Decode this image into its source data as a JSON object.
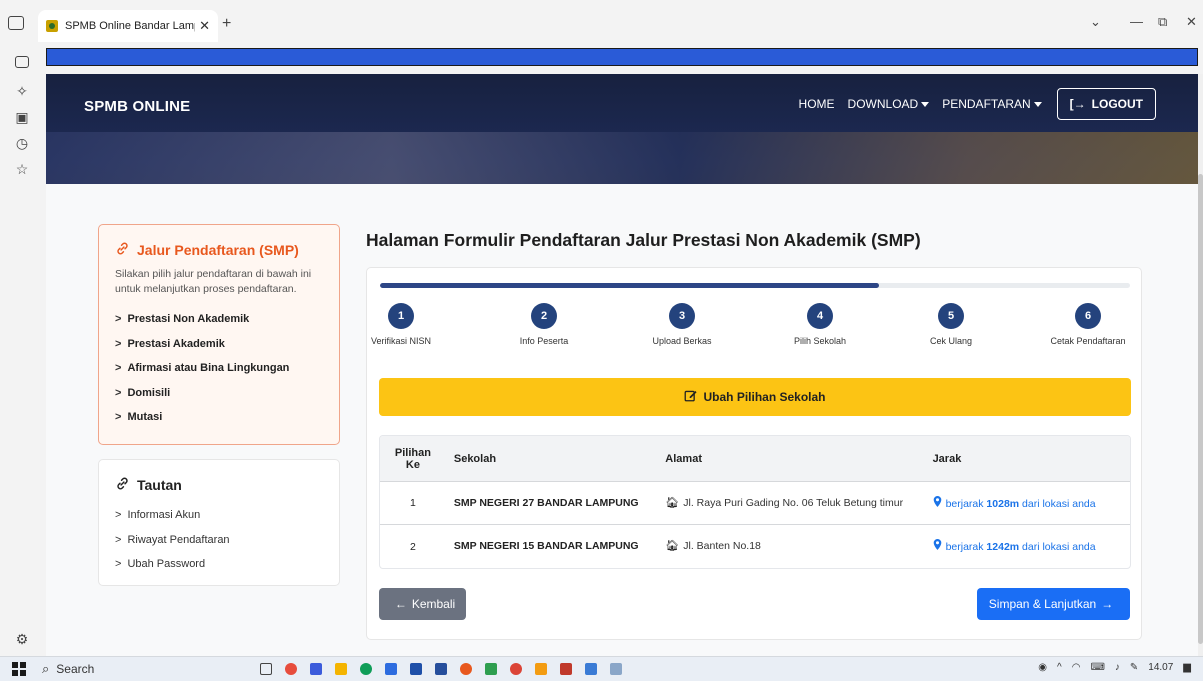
{
  "browser": {
    "tab_title": "SPMB Online Bandar Lampung",
    "tab_close": "✕",
    "new_tab": "+",
    "window_controls": {
      "minimize": "—",
      "restore": "⧉",
      "close": "✕",
      "dropdown": "⌄"
    }
  },
  "navbar": {
    "brand": "SPMB ONLINE",
    "items": [
      "HOME",
      "DOWNLOAD",
      "PENDAFTARAN"
    ],
    "logout": "LOGOUT"
  },
  "sidebar": {
    "jalur_title": "Jalur Pendaftaran (SMP)",
    "jalur_desc": "Silakan pilih jalur pendaftaran di bawah ini untuk melanjutkan proses pendaftaran.",
    "jalur_items": [
      "Prestasi Non Akademik",
      "Prestasi Akademik",
      "Afirmasi atau Bina Lingkungan",
      "Domisili",
      "Mutasi"
    ],
    "tautan_title": "Tautan",
    "tautan_items": [
      "Informasi Akun",
      "Riwayat Pendaftaran",
      "Ubah Password"
    ]
  },
  "main": {
    "title": "Halaman Formulir Pendaftaran Jalur Prestasi Non Akademik (SMP)",
    "progress_fraction": 0.665,
    "steps": [
      {
        "num": "1",
        "label": "Verifikasi NISN"
      },
      {
        "num": "2",
        "label": "Info Peserta"
      },
      {
        "num": "3",
        "label": "Upload Berkas"
      },
      {
        "num": "4",
        "label": "Pilih Sekolah"
      },
      {
        "num": "5",
        "label": "Cek Ulang"
      },
      {
        "num": "6",
        "label": "Cetak Pendaftaran"
      }
    ],
    "ubah_button": "Ubah Pilihan Sekolah",
    "table": {
      "headers": {
        "pilihan_l1": "Pilihan",
        "pilihan_l2": "Ke",
        "sekolah": "Sekolah",
        "alamat": "Alamat",
        "jarak": "Jarak"
      },
      "rows": [
        {
          "pilihan": "1",
          "sekolah": "SMP NEGERI 27 BANDAR LAMPUNG",
          "alamat": "Jl. Raya Puri Gading No. 06 Teluk Betung timur",
          "jarak_prefix": "berjarak",
          "jarak_value": "1028m",
          "jarak_suffix": "dari lokasi anda"
        },
        {
          "pilihan": "2",
          "sekolah": "SMP NEGERI 15 BANDAR LAMPUNG",
          "alamat": "Jl. Banten No.18",
          "jarak_prefix": "berjarak",
          "jarak_value": "1242m",
          "jarak_suffix": "dari lokasi anda"
        }
      ]
    },
    "btn_kembali": "Kembali",
    "btn_lanjut": "Simpan & Lanjutkan"
  },
  "taskbar": {
    "search_placeholder": "Search",
    "time": "14.07"
  },
  "colors": {
    "accent_orange": "#e8581e",
    "warning_yellow": "#fcc414",
    "primary_blue": "#1a6ef5",
    "step_navy": "#24437d",
    "secondary_gray": "#6b7280"
  }
}
